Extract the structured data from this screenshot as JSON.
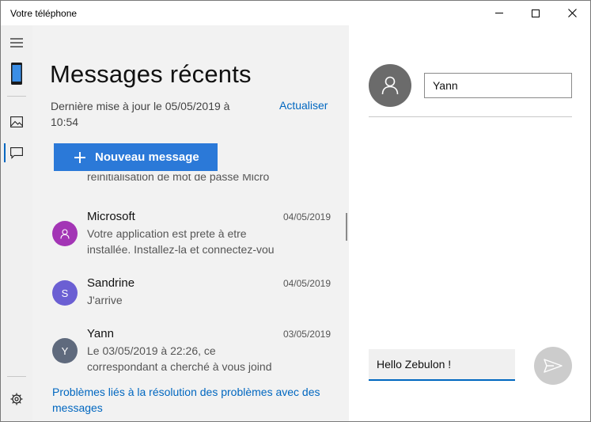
{
  "window": {
    "title": "Votre téléphone"
  },
  "panel": {
    "heading": "Messages récents",
    "last_update": "Dernière mise à jour le 05/05/2019 à 10:54",
    "refresh_label": "Actualiser",
    "new_message_label": "Nouveau message",
    "truncated_preview": "réinitialisation de mot de passe Micro",
    "conversations": [
      {
        "name": "Microsoft",
        "date": "04/05/2019",
        "preview": "Votre application est prete à etre\ninstallée. Installez-la et connectez-vou",
        "avatar": "person-icon",
        "color": "#a335b5"
      },
      {
        "name": "Sandrine",
        "date": "04/05/2019",
        "preview": "J'arrive",
        "initial": "S",
        "color": "#6b5fd3"
      },
      {
        "name": "Yann",
        "date": "03/05/2019",
        "preview": "Le 03/05/2019 à 22:26, ce\ncorrespondant a cherché à vous joind",
        "initial": "Y",
        "color": "#5f6a7d"
      }
    ],
    "trouble_link": "Problèmes liés à la résolution des problèmes avec des messages"
  },
  "conversation": {
    "recipient": "Yann",
    "compose_value": "Hello Zebulon !"
  },
  "theme": {
    "accent": "#0067c0",
    "button": "#2b79d8"
  }
}
